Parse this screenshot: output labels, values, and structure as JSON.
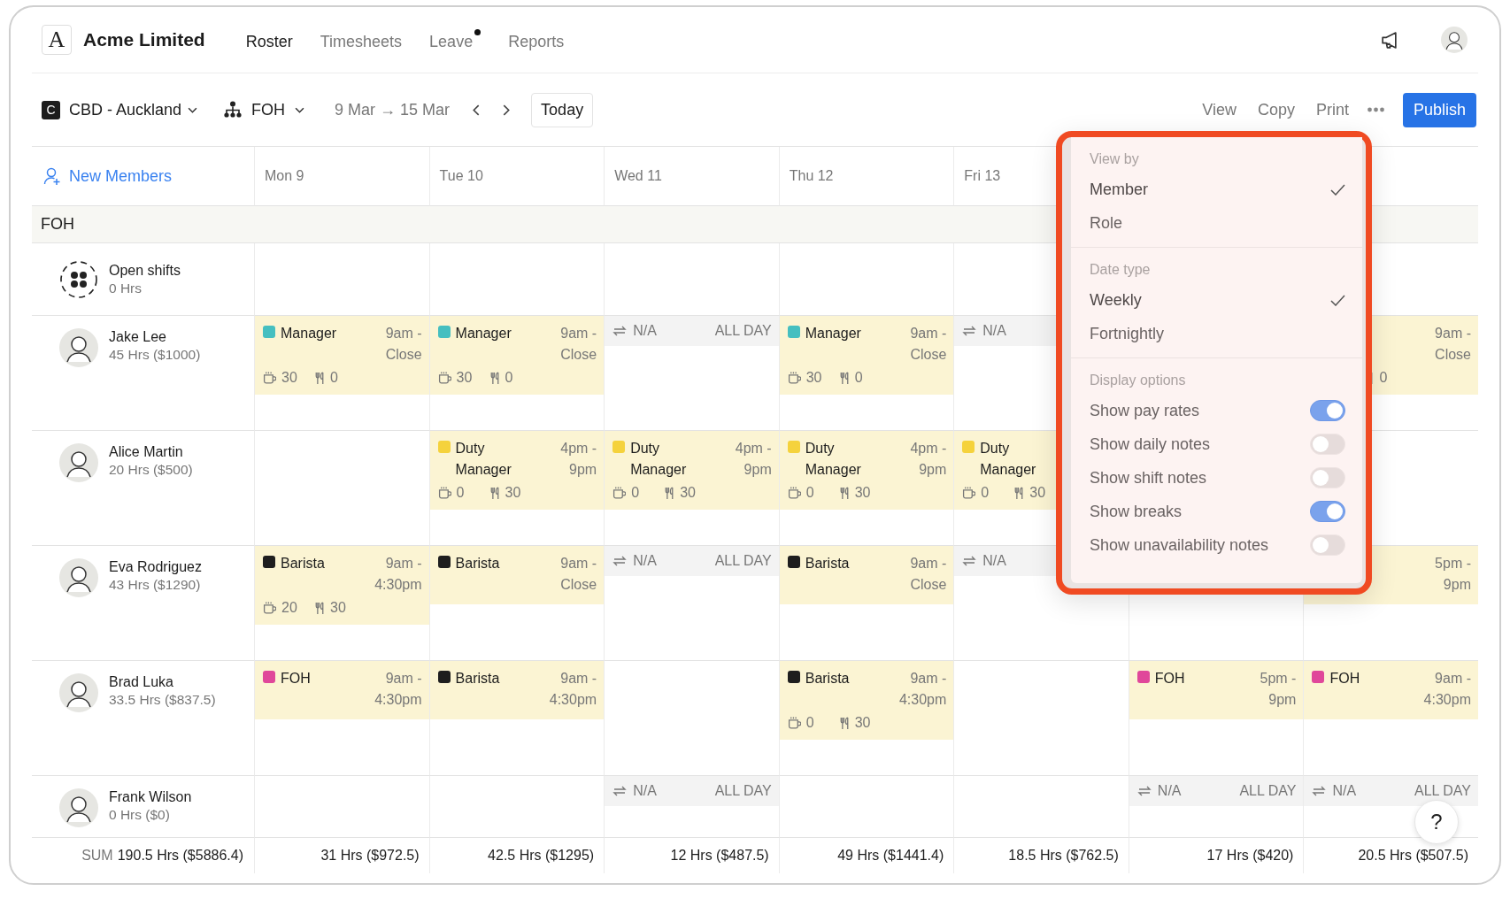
{
  "app": {
    "logo_letter": "A",
    "company": "Acme Limited"
  },
  "nav": [
    {
      "label": "Roster",
      "selected": true,
      "badge": false
    },
    {
      "label": "Timesheets",
      "selected": false,
      "badge": false
    },
    {
      "label": "Leave",
      "selected": false,
      "badge": true
    },
    {
      "label": "Reports",
      "selected": false,
      "badge": false
    }
  ],
  "toolbar": {
    "location_initial": "C",
    "location": "CBD - Auckland",
    "team": "FOH",
    "date_range": "9 Mar → 15 Mar",
    "today": "Today",
    "actions": [
      "View",
      "Copy",
      "Print"
    ],
    "publish": "Publish"
  },
  "grid": {
    "add_members": "New Members",
    "days": [
      "Mon 9",
      "Tue 10",
      "Wed 11",
      "Thu 12",
      "Fri 13"
    ],
    "group": "FOH",
    "rows": [
      {
        "kind": "open",
        "name": "Open shifts",
        "hours": "0 Hrs",
        "cells": [
          null,
          null,
          null,
          null,
          null,
          null,
          null
        ]
      },
      {
        "kind": "member",
        "name": "Jake Lee",
        "hours": "45 Hrs ($1000)",
        "cells": [
          {
            "kind": "shift",
            "role": "Manager",
            "color": "#45bfc0",
            "time": "9am - Close",
            "breaks": {
              "rest": "30",
              "meal": "0"
            }
          },
          {
            "kind": "shift",
            "role": "Manager",
            "color": "#45bfc0",
            "time": "9am - Close",
            "breaks": {
              "rest": "30",
              "meal": "0"
            }
          },
          {
            "kind": "unavailable",
            "label": "N/A",
            "duration": "ALL DAY"
          },
          {
            "kind": "shift",
            "role": "Manager",
            "color": "#45bfc0",
            "time": "9am - Close",
            "breaks": {
              "rest": "30",
              "meal": "0"
            }
          },
          {
            "kind": "unavailable",
            "label": "N/A"
          },
          null,
          {
            "kind": "shift",
            "time": "9am - Close",
            "breaks": {
              "meal": "0"
            }
          }
        ]
      },
      {
        "kind": "member",
        "name": "Alice Martin",
        "hours": "20 Hrs ($500)",
        "cells": [
          null,
          {
            "kind": "shift",
            "role": "Duty Manager",
            "color": "#f5d23c",
            "time": "4pm - 9pm",
            "breaks": {
              "rest": "0",
              "meal": "30"
            }
          },
          {
            "kind": "shift",
            "role": "Duty Manager",
            "color": "#f5d23c",
            "time": "4pm - 9pm",
            "breaks": {
              "rest": "0",
              "meal": "30"
            }
          },
          {
            "kind": "shift",
            "role": "Duty Manager",
            "color": "#f5d23c",
            "time": "4pm - 9pm",
            "breaks": {
              "rest": "0",
              "meal": "30"
            }
          },
          {
            "kind": "shift",
            "role": "Duty Manager",
            "color": "#f5d23c",
            "breaks": {
              "rest": "0",
              "meal": "30"
            }
          },
          null,
          null
        ]
      },
      {
        "kind": "member",
        "name": "Eva Rodriguez",
        "hours": "43 Hrs ($1290)",
        "cells": [
          {
            "kind": "shift",
            "role": "Barista",
            "color": "#1e1e1e",
            "time": "9am - 4:30pm",
            "breaks": {
              "rest": "20",
              "meal": "30"
            }
          },
          {
            "kind": "shift",
            "role": "Barista",
            "color": "#1e1e1e",
            "time": "9am - Close"
          },
          {
            "kind": "unavailable",
            "label": "N/A",
            "duration": "ALL DAY"
          },
          {
            "kind": "shift",
            "role": "Barista",
            "color": "#1e1e1e",
            "time": "9am - Close"
          },
          {
            "kind": "unavailable",
            "label": "N/A"
          },
          null,
          {
            "kind": "shift",
            "time": "5pm - 9pm"
          }
        ]
      },
      {
        "kind": "member",
        "name": "Brad Luka",
        "hours": "33.5 Hrs ($837.5)",
        "cells": [
          {
            "kind": "shift",
            "role": "FOH",
            "color": "#e0479a",
            "time": "9am - 4:30pm"
          },
          {
            "kind": "shift",
            "role": "Barista",
            "color": "#1e1e1e",
            "time": "9am - 4:30pm"
          },
          null,
          {
            "kind": "shift",
            "role": "Barista",
            "color": "#1e1e1e",
            "time": "9am - 4:30pm",
            "breaks": {
              "rest": "0",
              "meal": "30"
            }
          },
          null,
          {
            "kind": "shift",
            "role": "FOH",
            "color": "#e0479a",
            "time": "5pm - 9pm"
          },
          {
            "kind": "shift",
            "role": "FOH",
            "color": "#e0479a",
            "time": "9am - 4:30pm"
          }
        ]
      },
      {
        "kind": "member",
        "name": "Frank Wilson",
        "hours": "0 Hrs ($0)",
        "cells": [
          null,
          null,
          {
            "kind": "unavailable",
            "label": "N/A",
            "duration": "ALL DAY"
          },
          null,
          null,
          {
            "kind": "unavailable",
            "label": "N/A",
            "duration": "ALL DAY"
          },
          {
            "kind": "unavailable",
            "label": "N/A",
            "duration": "ALL DAY"
          }
        ]
      }
    ],
    "sum": {
      "label": "SUM",
      "total": "190.5 Hrs ($5886.4)",
      "days": [
        "31 Hrs ($972.5)",
        "42.5 Hrs ($1295)",
        "12 Hrs ($487.5)",
        "49 Hrs ($1441.4)",
        "18.5 Hrs ($762.5)",
        "17 Hrs ($420)",
        "20.5 Hrs ($507.5)"
      ]
    }
  },
  "menu": {
    "sections": [
      {
        "heading": "View by",
        "items": [
          {
            "kind": "option",
            "label": "Member",
            "selected": true
          },
          {
            "kind": "option",
            "label": "Role",
            "selected": false
          }
        ]
      },
      {
        "heading": "Date type",
        "items": [
          {
            "kind": "option",
            "label": "Weekly",
            "selected": true
          },
          {
            "kind": "option",
            "label": "Fortnightly",
            "selected": false
          }
        ]
      },
      {
        "heading": "Display options",
        "items": [
          {
            "kind": "toggle",
            "label": "Show pay rates",
            "on": true
          },
          {
            "kind": "toggle",
            "label": "Show daily notes",
            "on": false
          },
          {
            "kind": "toggle",
            "label": "Show shift notes",
            "on": false
          },
          {
            "kind": "toggle",
            "label": "Show breaks",
            "on": true
          },
          {
            "kind": "toggle",
            "label": "Show unavailability notes",
            "on": false
          }
        ]
      }
    ]
  },
  "help": {
    "label": "?"
  }
}
